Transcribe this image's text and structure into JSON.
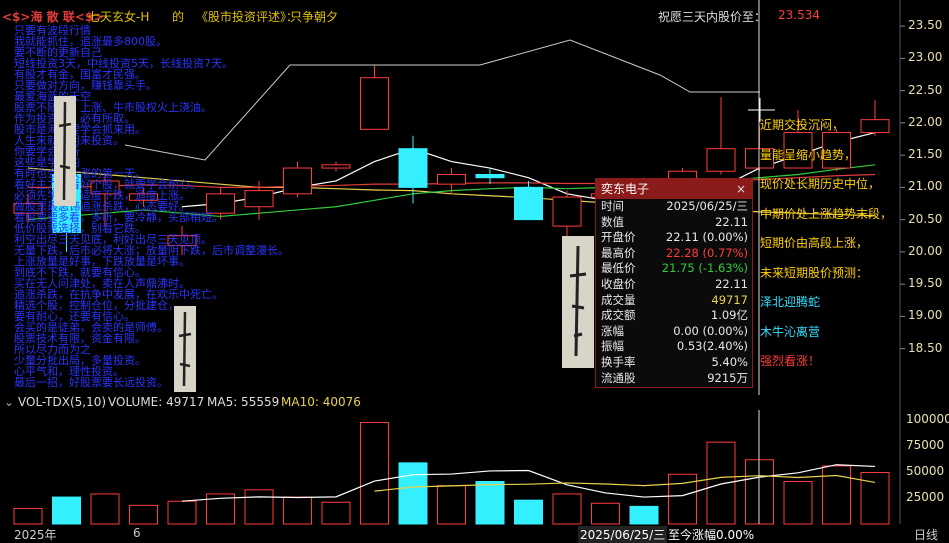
{
  "header": {
    "tag": "<$>海 散 联<$>",
    "author": "七天玄女-H",
    "de": "的",
    "book": "《股市投资评述》：",
    "motto": "只争朝夕",
    "wish_label": "祝愿三天内股价至：",
    "wish_value": "23.534"
  },
  "colors": {
    "up": "#ff3b3b",
    "down": "#34f0ff",
    "ma_white": "#ffffff",
    "ma_yellow": "#e8d24a",
    "ma_green": "#2fce3a",
    "ma_red": "#e13a3a",
    "overlay_text": "#2a34ff",
    "note": "#ffd200"
  },
  "price_axis": {
    "ticks": [
      "23.50",
      "23.00",
      "22.50",
      "22.00",
      "21.50",
      "21.00",
      "20.50",
      "20.00",
      "19.50",
      "19.00",
      "18.50"
    ],
    "min": 18.2,
    "max": 23.75
  },
  "volume_axis": {
    "ticks": [
      "100000",
      "75000",
      "50000",
      "25000"
    ],
    "max": 110000
  },
  "overlay_lines": [
    "只要有波段行情",
    "我就能抓住，追涨最多800股。",
    "要不断的更新自己",
    "短线投资3天，中线投资5天，长线投资7天。",
    "有股才有金，国富才民强。",
    "只要做对方向，赚钱靠头手。",
    "最爱海蓝的天空",
    "股票不随意，上涨、牛市股权火上浇油。",
    "作为投资人，必有所取。",
    "股市是海，要学会抓来用。",
    "人生来就是用来投资。",
    "你要学会分析",
    "这些是学习的",
    "有时也会有大涨的第一天。",
    "看好主力，看好个股，就要学会耐心。",
    "必须先学会，适度下跌，适度上涨。",
    "做股票最忌讳追涨杀跌，心态要好。",
    "看股票要多看，多听，要冷静，头部稍短。",
    "低价股票选择，别看它跌。",
    "利空出尽三天见底，利好出尽三天见顶。",
    "无量下跌，后市必将大涨；放量阴下跌，后市调整漫长。",
    "上涨放量是好事，下跌放量是坏事。",
    "到底不下跌，就要有信心。",
    "买在无人问津处，卖在人声鼎沸时。",
    "追涨杀跌，在抗争中发展，在欢乐中死亡。",
    "精选个股，控制仓位，分批建仓，",
    "要有耐心，还要有信心。",
    "会买的是徒弟，会卖的是师傅。",
    "股票技术有限，资金有限。",
    "所以尽力而为之",
    "少量分批出局，多量投资。",
    "心平气和，理性投资。",
    "最后一招，好股票要长远投资。"
  ],
  "right_notes": [
    {
      "text": "近期交投沉闷，",
      "color": "#ffd200"
    },
    {
      "text": "量能呈缩小趋势，",
      "color": "#ffd200"
    },
    {
      "text": "现价处长期历史中位，",
      "color": "#ffd200"
    },
    {
      "text": "中期价处上涨趋势末段，",
      "color": "#ffd200"
    },
    {
      "text": "短期价由高段上涨，",
      "color": "#ffd200"
    },
    {
      "text": "未来短期股价预测：",
      "color": "#ffd200"
    },
    {
      "text": "泽北迎腾蛇",
      "color": "#34e0ff"
    },
    {
      "text": "木牛沁离营",
      "color": "#34e0ff"
    },
    {
      "text": "强烈看涨！",
      "color": "#ff3b3b"
    }
  ],
  "tooltip": {
    "title": "奕东电子",
    "close": "×",
    "rows": [
      {
        "label": "时间",
        "value": "2025/06/25/三",
        "color": "#e8e8e8"
      },
      {
        "label": "数值",
        "value": "22.11",
        "color": "#e8e8e8"
      },
      {
        "label": "开盘价",
        "value": "22.11 (0.00%)",
        "color": "#e8e8e8"
      },
      {
        "label": "最高价",
        "value": "22.28 (0.77%)",
        "color": "#ff3b3b"
      },
      {
        "label": "最低价",
        "value": "21.75 (-1.63%)",
        "color": "#2fce3a"
      },
      {
        "label": "收盘价",
        "value": "22.11",
        "color": "#e8e8e8"
      },
      {
        "label": "成交量",
        "value": "49717",
        "color": "#e8d24a"
      },
      {
        "label": "成交额",
        "value": "1.09亿",
        "color": "#e8e8e8"
      },
      {
        "label": "涨幅",
        "value": "0.00 (0.00%)",
        "color": "#e8e8e8"
      },
      {
        "label": "振幅",
        "value": "0.53(2.40%)",
        "color": "#e8e8e8"
      },
      {
        "label": "换手率",
        "value": "5.40%",
        "color": "#e8e8e8"
      },
      {
        "label": "流通股",
        "value": "9215万",
        "color": "#e8e8e8"
      }
    ]
  },
  "volume_header": {
    "name": "VOL-TDX(5,10)",
    "volume": "VOLUME: 49717",
    "ma5": "MA5: 55559",
    "ma10": "MA10: 40076"
  },
  "x_axis": {
    "year": "2025年",
    "month": "6",
    "cursor_label": "2025/06/25/三",
    "change_label": "至今涨幅0.00%",
    "period": "日线"
  },
  "chart_data": {
    "type": "candlestick",
    "candles": [
      {
        "o": 20.6,
        "h": 20.9,
        "l": 20.45,
        "c": 20.75
      },
      {
        "o": 21.2,
        "h": 21.4,
        "l": 20.0,
        "c": 20.3
      },
      {
        "o": 20.9,
        "h": 21.2,
        "l": 20.4,
        "c": 21.1
      },
      {
        "o": 20.8,
        "h": 21.0,
        "l": 20.7,
        "c": 20.9
      },
      {
        "o": 20.1,
        "h": 20.4,
        "l": 19.95,
        "c": 20.25
      },
      {
        "o": 20.6,
        "h": 21.0,
        "l": 20.5,
        "c": 20.9
      },
      {
        "o": 20.7,
        "h": 21.1,
        "l": 20.5,
        "c": 20.95
      },
      {
        "o": 20.9,
        "h": 21.4,
        "l": 20.85,
        "c": 21.3
      },
      {
        "o": 21.3,
        "h": 21.4,
        "l": 21.25,
        "c": 21.35
      },
      {
        "o": 21.9,
        "h": 22.9,
        "l": 21.9,
        "c": 22.7
      },
      {
        "o": 21.6,
        "h": 21.8,
        "l": 20.75,
        "c": 21.0
      },
      {
        "o": 21.05,
        "h": 21.3,
        "l": 20.9,
        "c": 21.2
      },
      {
        "o": 21.2,
        "h": 21.3,
        "l": 21.05,
        "c": 21.15
      },
      {
        "o": 21.0,
        "h": 21.1,
        "l": 20.5,
        "c": 20.5
      },
      {
        "o": 20.4,
        "h": 20.95,
        "l": 20.2,
        "c": 20.85
      },
      {
        "o": 20.85,
        "h": 21.05,
        "l": 20.7,
        "c": 20.9
      },
      {
        "o": 21.05,
        "h": 21.15,
        "l": 20.7,
        "c": 20.85
      },
      {
        "o": 20.7,
        "h": 21.3,
        "l": 20.7,
        "c": 21.25
      },
      {
        "o": 21.25,
        "h": 22.4,
        "l": 21.2,
        "c": 21.6
      },
      {
        "o": 21.3,
        "h": 21.95,
        "l": 21.25,
        "c": 21.6
      },
      {
        "o": 21.3,
        "h": 22.2,
        "l": 21.3,
        "c": 21.85
      },
      {
        "o": 21.3,
        "h": 21.9,
        "l": 21.25,
        "c": 21.85
      },
      {
        "o": 21.85,
        "h": 22.35,
        "l": 21.8,
        "c": 22.05
      }
    ],
    "volumes": [
      15000,
      26000,
      29000,
      18000,
      22000,
      29000,
      33000,
      26000,
      21000,
      98000,
      59000,
      37000,
      41000,
      23000,
      29000,
      20000,
      17000,
      48000,
      79000,
      62000,
      41000,
      56000,
      49717
    ],
    "ma_lines": [
      {
        "name": "white",
        "values": [
          null,
          null,
          null,
          null,
          20.7,
          20.75,
          20.85,
          21.0,
          21.1,
          21.4,
          21.6,
          21.4,
          21.3,
          21.15,
          20.9,
          20.8,
          20.75,
          20.9,
          21.0,
          21.3,
          21.5,
          21.7,
          21.85
        ]
      },
      {
        "name": "yellow",
        "values": [
          21.3,
          21.25,
          21.2,
          21.15,
          21.1,
          21.05,
          21.0,
          21.0,
          20.98,
          20.96,
          20.95,
          20.9,
          20.87,
          20.84,
          20.8,
          20.76,
          20.72,
          20.68,
          20.65,
          20.62,
          20.6,
          20.58,
          20.56
        ]
      },
      {
        "name": "green",
        "values": [
          20.5,
          20.55,
          20.6,
          20.65,
          20.6,
          20.55,
          20.6,
          20.65,
          20.7,
          20.8,
          20.9,
          20.95,
          20.98,
          21.0,
          20.98,
          21.0,
          21.02,
          21.05,
          21.1,
          21.15,
          21.2,
          21.28,
          21.35
        ]
      },
      {
        "name": "red",
        "values": [
          21.0,
          21.0,
          21.02,
          21.04,
          21.03,
          21.0,
          21.0,
          21.02,
          21.03,
          21.05,
          21.05,
          21.06,
          21.07,
          21.07,
          21.06,
          21.06,
          21.07,
          21.08,
          21.1,
          21.12,
          21.15,
          21.18,
          21.2
        ]
      }
    ],
    "vol_ma": [
      {
        "name": "white",
        "values": [
          null,
          null,
          null,
          null,
          22000,
          24800,
          26200,
          25600,
          26200,
          41400,
          47600,
          48200,
          51200,
          51600,
          37800,
          30000,
          26000,
          27400,
          38600,
          45200,
          49400,
          57200,
          55559
        ]
      },
      {
        "name": "yellow",
        "values": [
          null,
          null,
          null,
          null,
          null,
          null,
          null,
          null,
          null,
          31700,
          35700,
          36800,
          38000,
          38400,
          39600,
          38600,
          37000,
          39200,
          45000,
          46600,
          44900,
          46800,
          40076
        ]
      }
    ],
    "ylim": [
      18.2,
      23.75
    ],
    "vol_ylim": [
      0,
      110000
    ]
  }
}
